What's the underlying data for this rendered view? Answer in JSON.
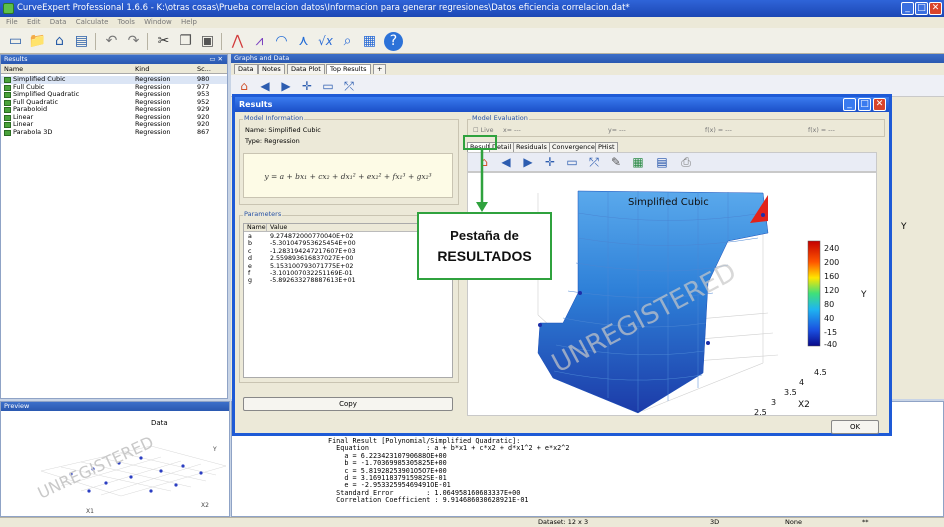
{
  "window": {
    "title": "CurveExpert Professional 1.6.6 - K:\\otras cosas\\Prueba correlacion datos\\Informacion para generar regresiones\\Datos eficiencia correlacion.dat*",
    "minimize": "_",
    "maximize": "□",
    "close": "✕"
  },
  "menu": [
    "File",
    "Edit",
    "Data",
    "Calculate",
    "Tools",
    "Window",
    "Help"
  ],
  "results_panel": {
    "title": "Results",
    "columns": [
      "Name",
      "Kind",
      "Sc..."
    ],
    "rows": [
      {
        "name": "Simplified Cubic",
        "kind": "Regression",
        "score": "980"
      },
      {
        "name": "Full Cubic",
        "kind": "Regression",
        "score": "977"
      },
      {
        "name": "Simplified Quadratic",
        "kind": "Regression",
        "score": "953"
      },
      {
        "name": "Full Quadratic",
        "kind": "Regression",
        "score": "952"
      },
      {
        "name": "Paraboloid",
        "kind": "Regression",
        "score": "929"
      },
      {
        "name": "Linear",
        "kind": "Regression",
        "score": "920"
      },
      {
        "name": "Linear",
        "kind": "Regression",
        "score": "920"
      },
      {
        "name": "Parabola 3D",
        "kind": "Regression",
        "score": "867"
      }
    ]
  },
  "preview_panel": {
    "title": "Preview",
    "chart_title": "Data",
    "z_label": "Y",
    "x_label": "X1",
    "y_label": "X2"
  },
  "graphs_panel": {
    "title": "Graphs and Data",
    "tabs": [
      "Data",
      "Notes",
      "Data Plot",
      "Top Results",
      "+"
    ]
  },
  "dialog": {
    "title": "Results",
    "model_info_label": "Model Information",
    "name_line": "Name: Simplified Cubic",
    "type_line": "Type: Regression",
    "equation": "y = a + bx₁ + cx₂ + dx₁² + ex₂² + fx₁³ + gx₂³",
    "parameters_label": "Parameters",
    "param_columns": [
      "Name",
      "Value"
    ],
    "params": [
      {
        "name": "a",
        "value": "9.274872000770040E+02"
      },
      {
        "name": "b",
        "value": "-5.301047953625454E+00"
      },
      {
        "name": "c",
        "value": "-1.283194247217607E+03"
      },
      {
        "name": "d",
        "value": "2.559893616837027E+00"
      },
      {
        "name": "e",
        "value": "5.153100793071775E+02"
      },
      {
        "name": "f",
        "value": "-3.101007032251169E-01"
      },
      {
        "name": "g",
        "value": "-5.892633278887613E+01"
      }
    ],
    "copy_button": "Copy",
    "ok_button": "OK",
    "model_eval_label": "Model Evaluation",
    "eval": {
      "live": "Live",
      "x": "x= ---",
      "y": "y= ---",
      "fx1": "f(x) = ---",
      "fx2": "f(x) = ---"
    },
    "result_tabs": [
      "Result",
      "Detail",
      "Residuals",
      "Convergence",
      "PHist"
    ]
  },
  "plot": {
    "title": "Simplified Cubic",
    "z_label": "Y",
    "colorbar_ticks": [
      "240",
      "200",
      "160",
      "120",
      "80",
      "40",
      "-15",
      "-40"
    ],
    "colorbar_range": [
      -40,
      260
    ],
    "axis_right_ticks": [
      "4.5",
      "4",
      "3.5",
      "3",
      "2.5"
    ],
    "axis_right_label": "X2",
    "colors": {
      "low": "#0c1c9e",
      "mid": "#1f9ff2",
      "high": "#ff2200"
    }
  },
  "callout": {
    "line1": "Pestaña de",
    "line2": "RESULTADOS",
    "color": "#2fa23e"
  },
  "output": {
    "lines": [
      "Final Result [Polynomial/Simplified Quadratic]:",
      "  Equation              : a + b*x1 + c*x2 + d*x1^2 + e*x2^2",
      "    a = 6.22342310790688OE+00",
      "    b = -1.70369985305825E+00",
      "    c = 5.81928253901O5O7E+00",
      "    d = 3.16911837915982SE-01",
      "    e = -2.95332595469491OE-01",
      "  Standard Error        : 1.064958160683337E+00",
      "  Correlation Coefficient : 9.914686030628921E-01"
    ]
  },
  "status": {
    "dataset": "Dataset: 12 x 3",
    "mode": "3D",
    "selection": "None",
    "flag": "**"
  },
  "watermark": "UNREGISTERED"
}
